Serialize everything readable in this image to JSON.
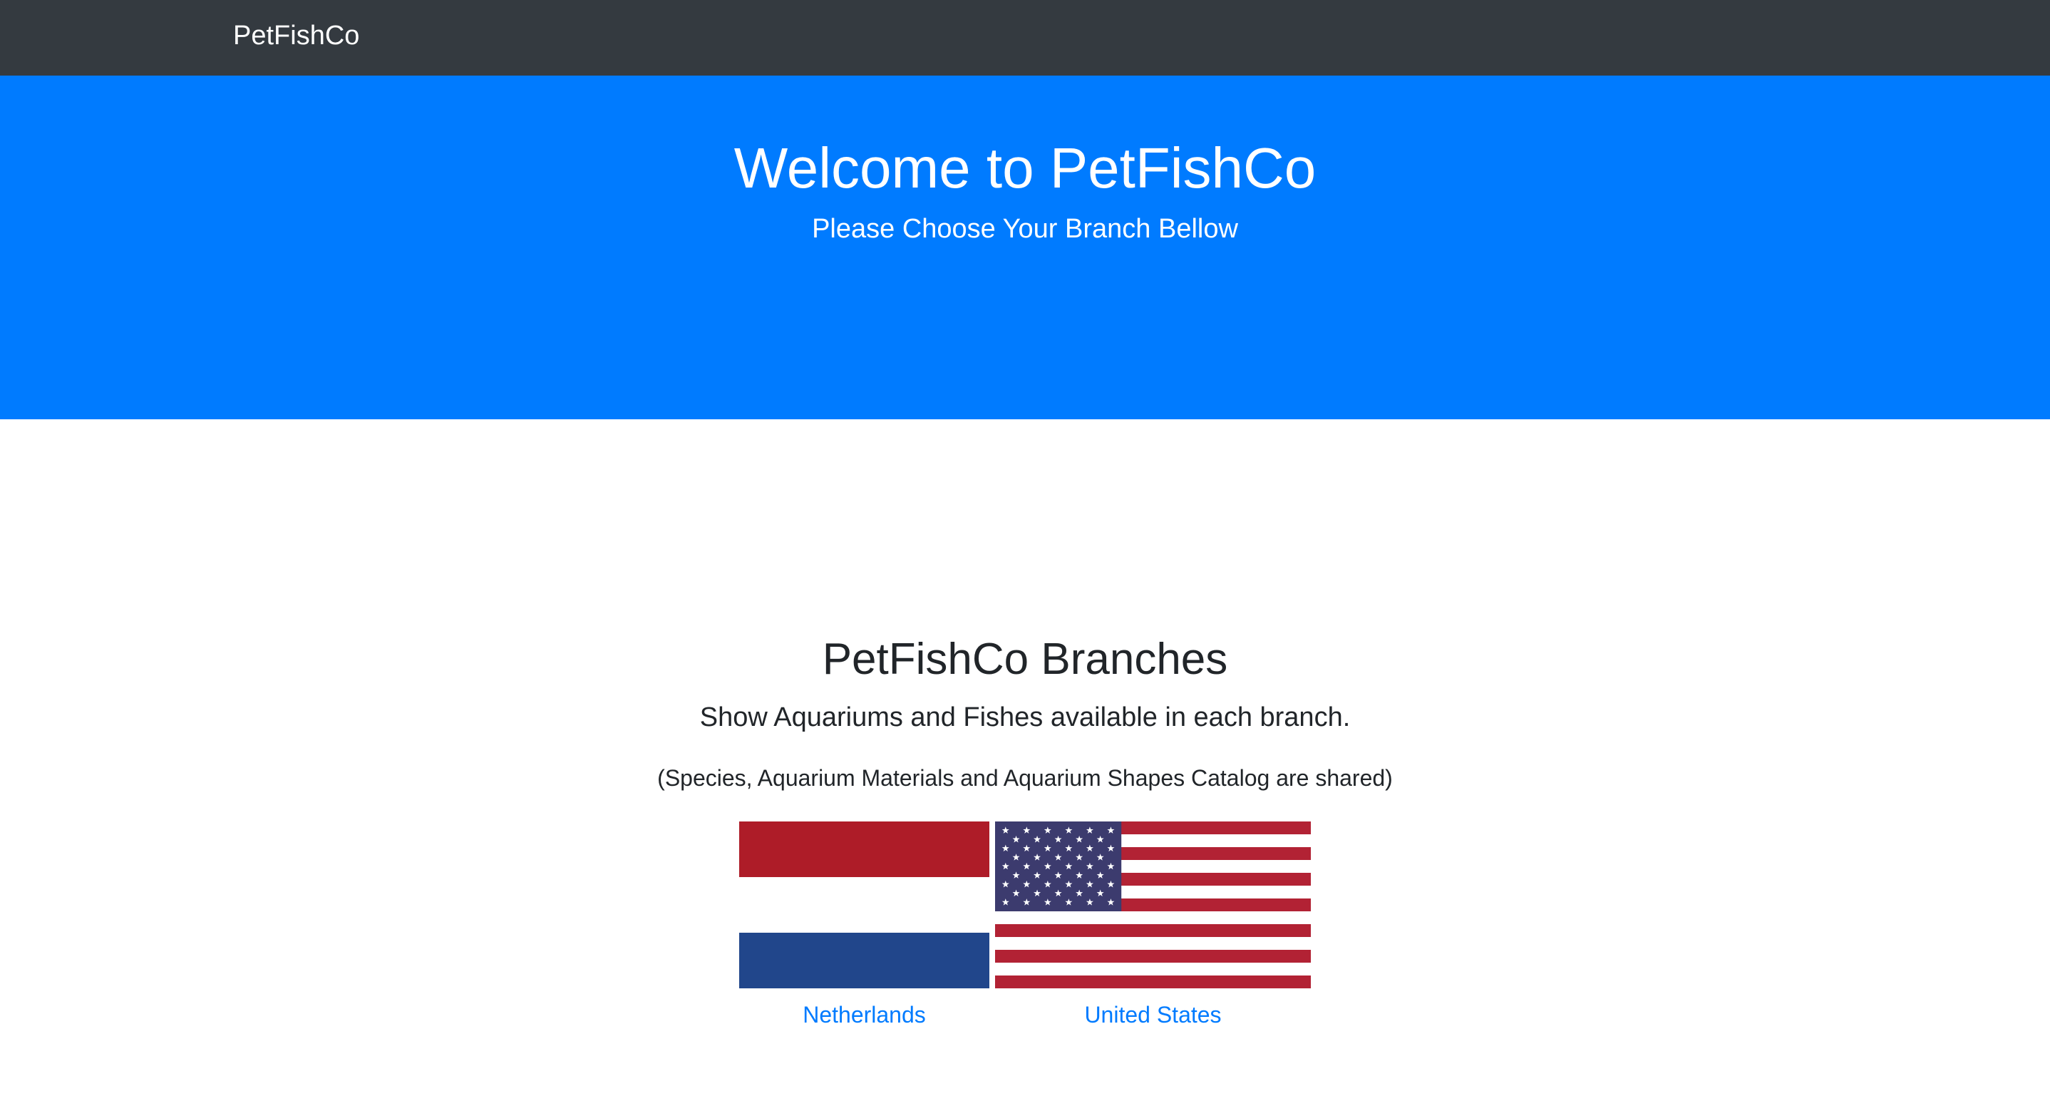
{
  "navbar": {
    "brand": "PetFishCo"
  },
  "hero": {
    "title": "Welcome to PetFishCo",
    "subtitle": "Please Choose Your Branch Bellow"
  },
  "branches": {
    "title": "PetFishCo Branches",
    "lead": "Show Aquariums and Fishes available in each branch.",
    "note": "(Species, Aquarium Materials and Aquarium Shapes Catalog are shared)",
    "items": [
      {
        "label": "Netherlands",
        "flag_icon": "netherlands-flag-icon"
      },
      {
        "label": "United States",
        "flag_icon": "united-states-flag-icon"
      }
    ]
  },
  "colors": {
    "navbar_bg": "#343a40",
    "hero_bg": "#007bff",
    "link": "#007bff",
    "text_dark": "#212529",
    "nl_red": "#ae1c28",
    "nl_blue": "#21468b",
    "us_red": "#b22234",
    "us_blue": "#3c3b6e"
  }
}
